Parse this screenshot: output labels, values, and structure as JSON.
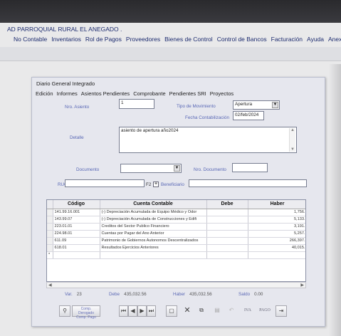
{
  "app": {
    "title": "AD PARROQUIAL RURAL EL ANEGADO .",
    "menu": [
      "No Contable",
      "Inventarios",
      "Rol de Pagos",
      "Proveedores",
      "Bienes de Control",
      "Control de Bancos",
      "Facturación",
      "Ayuda",
      "Anexo"
    ]
  },
  "window": {
    "title": "Diario General Integrado",
    "menu": [
      "Edición",
      "Informes",
      "Asientos Pendientes",
      "Comprobante",
      "Pendientes SRI",
      "Proyectos"
    ]
  },
  "form": {
    "nro_asiento_label": "Nro. Asiento",
    "nro_asiento_value": "1",
    "tipo_movimiento_label": "Tipo de Movimiento",
    "tipo_movimiento_value": "Apertura",
    "fecha_label": "Fecha Contabilización",
    "fecha_value": "02/feb/2024",
    "detalle_label": "Detalle",
    "detalle_value": "asiento de apertura año2024",
    "documento_label": "Documento",
    "documento_value": "",
    "nro_documento_label": "Nro. Documento",
    "nro_documento_value": "",
    "ruc_label": "RUC:",
    "ruc_value": "",
    "f2_label": "F2",
    "beneficiario_label": "Beneficiario",
    "beneficiario_value": ""
  },
  "grid": {
    "headers": [
      "Código",
      "Cuenta Contable",
      "Debe",
      "Haber"
    ],
    "rows": [
      {
        "codigo": "141.99.16.001",
        "cuenta": "(-) Depreciación Acumulada de Equipo Médico y Odor",
        "debe": "",
        "haber": "1,756."
      },
      {
        "codigo": "143.99.07",
        "cuenta": "(-) Depreciación Acumulada de Construcciones  y Edifi",
        "debe": "",
        "haber": "5,133."
      },
      {
        "codigo": "223.01.01",
        "cuenta": "Creditos del Sector Publico Financiero",
        "debe": "",
        "haber": "3,191."
      },
      {
        "codigo": "224.98.01",
        "cuenta": "Cuentas por Pagar del Ano Anterior",
        "debe": "",
        "haber": "5,257."
      },
      {
        "codigo": "611.09",
        "cuenta": "Patrimonio de Gobiernos Autonomos Descentralizados",
        "debe": "",
        "haber": "266,397."
      },
      {
        "codigo": "618.01",
        "cuenta": "Resultados Ejercicios Anteriores",
        "debe": "",
        "haber": "40,015."
      }
    ],
    "new_row_marker": "*"
  },
  "totals": {
    "var_label": "Var.",
    "var_value": "23",
    "debe_label": "Debe",
    "debe_value": "435,032.56",
    "haber_label": "Haber",
    "haber_value": "435,032.56",
    "saldo_label": "Saldo",
    "saldo_value": "0.00"
  },
  "buttons": {
    "comp_label_1": "Comp. Derogado",
    "comp_label_2": "Comp. Pago",
    "iva_label": "IVA",
    "pago_label": "PAGO"
  }
}
